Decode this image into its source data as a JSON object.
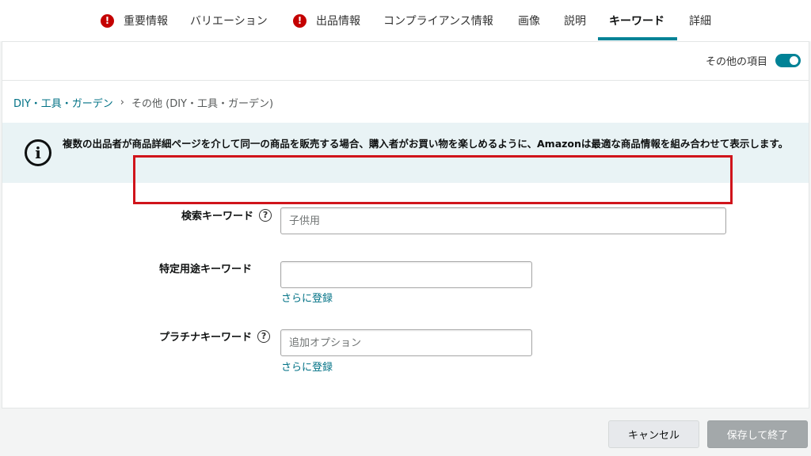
{
  "tabs": [
    {
      "label": "重要情報",
      "alert": true
    },
    {
      "label": "バリエーション",
      "alert": false
    },
    {
      "label": "出品情報",
      "alert": true
    },
    {
      "label": "コンプライアンス情報",
      "alert": false
    },
    {
      "label": "画像",
      "alert": false
    },
    {
      "label": "説明",
      "alert": false
    },
    {
      "label": "キーワード",
      "alert": false,
      "active": true
    },
    {
      "label": "詳細",
      "alert": false
    }
  ],
  "alert_glyph": "!",
  "toggle": {
    "label": "その他の項目",
    "on": true
  },
  "breadcrumb": {
    "parent": "DIY・工具・ガーデン",
    "separator": "›",
    "current": "その他 (DIY・工具・ガーデン)"
  },
  "info": {
    "icon_glyph": "i",
    "text": "複数の出品者が商品詳細ページを介して同一の商品を販売する場合、購入者がお買い物を楽しめるように、Amazonは最適な商品情報を組み合わせて表示します。"
  },
  "fields": {
    "search_keywords": {
      "label": "検索キーワード",
      "help": "?",
      "value": "",
      "placeholder": "子供用"
    },
    "intended_use": {
      "label": "特定用途キーワード",
      "value": "",
      "placeholder": "",
      "more_link": "さらに登録"
    },
    "platinum": {
      "label": "プラチナキーワード",
      "help": "?",
      "value": "",
      "placeholder": "追加オプション",
      "more_link": "さらに登録"
    }
  },
  "footer": {
    "cancel_label": "キャンセル",
    "save_label": "保存して終了"
  },
  "colors": {
    "accent": "#008296",
    "alert": "#c40000",
    "highlight": "#d0141b"
  }
}
